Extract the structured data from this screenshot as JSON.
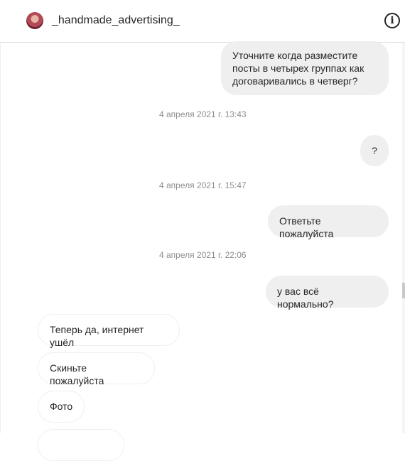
{
  "header": {
    "username": "_handmade_advertising_",
    "info_icon": "info-icon"
  },
  "messages": [
    {
      "side": "out",
      "text": "Уточните когда разместите посты в четырех группах как договаривались в четверг?"
    },
    {
      "side": "time",
      "text": "4 апреля 2021 г. 13:43"
    },
    {
      "side": "out",
      "text": "?"
    },
    {
      "side": "time",
      "text": "4 апреля 2021 г. 15:47"
    },
    {
      "side": "out",
      "text": "Ответьте пожалуйста"
    },
    {
      "side": "time",
      "text": "4 апреля 2021 г. 22:06"
    },
    {
      "side": "out",
      "text": "у вас всё нормально?"
    },
    {
      "side": "in",
      "text": "Теперь да, интернет ушёл"
    },
    {
      "side": "in",
      "text": "Скиньте пожалуйста"
    },
    {
      "side": "in",
      "text": "Фото"
    }
  ]
}
